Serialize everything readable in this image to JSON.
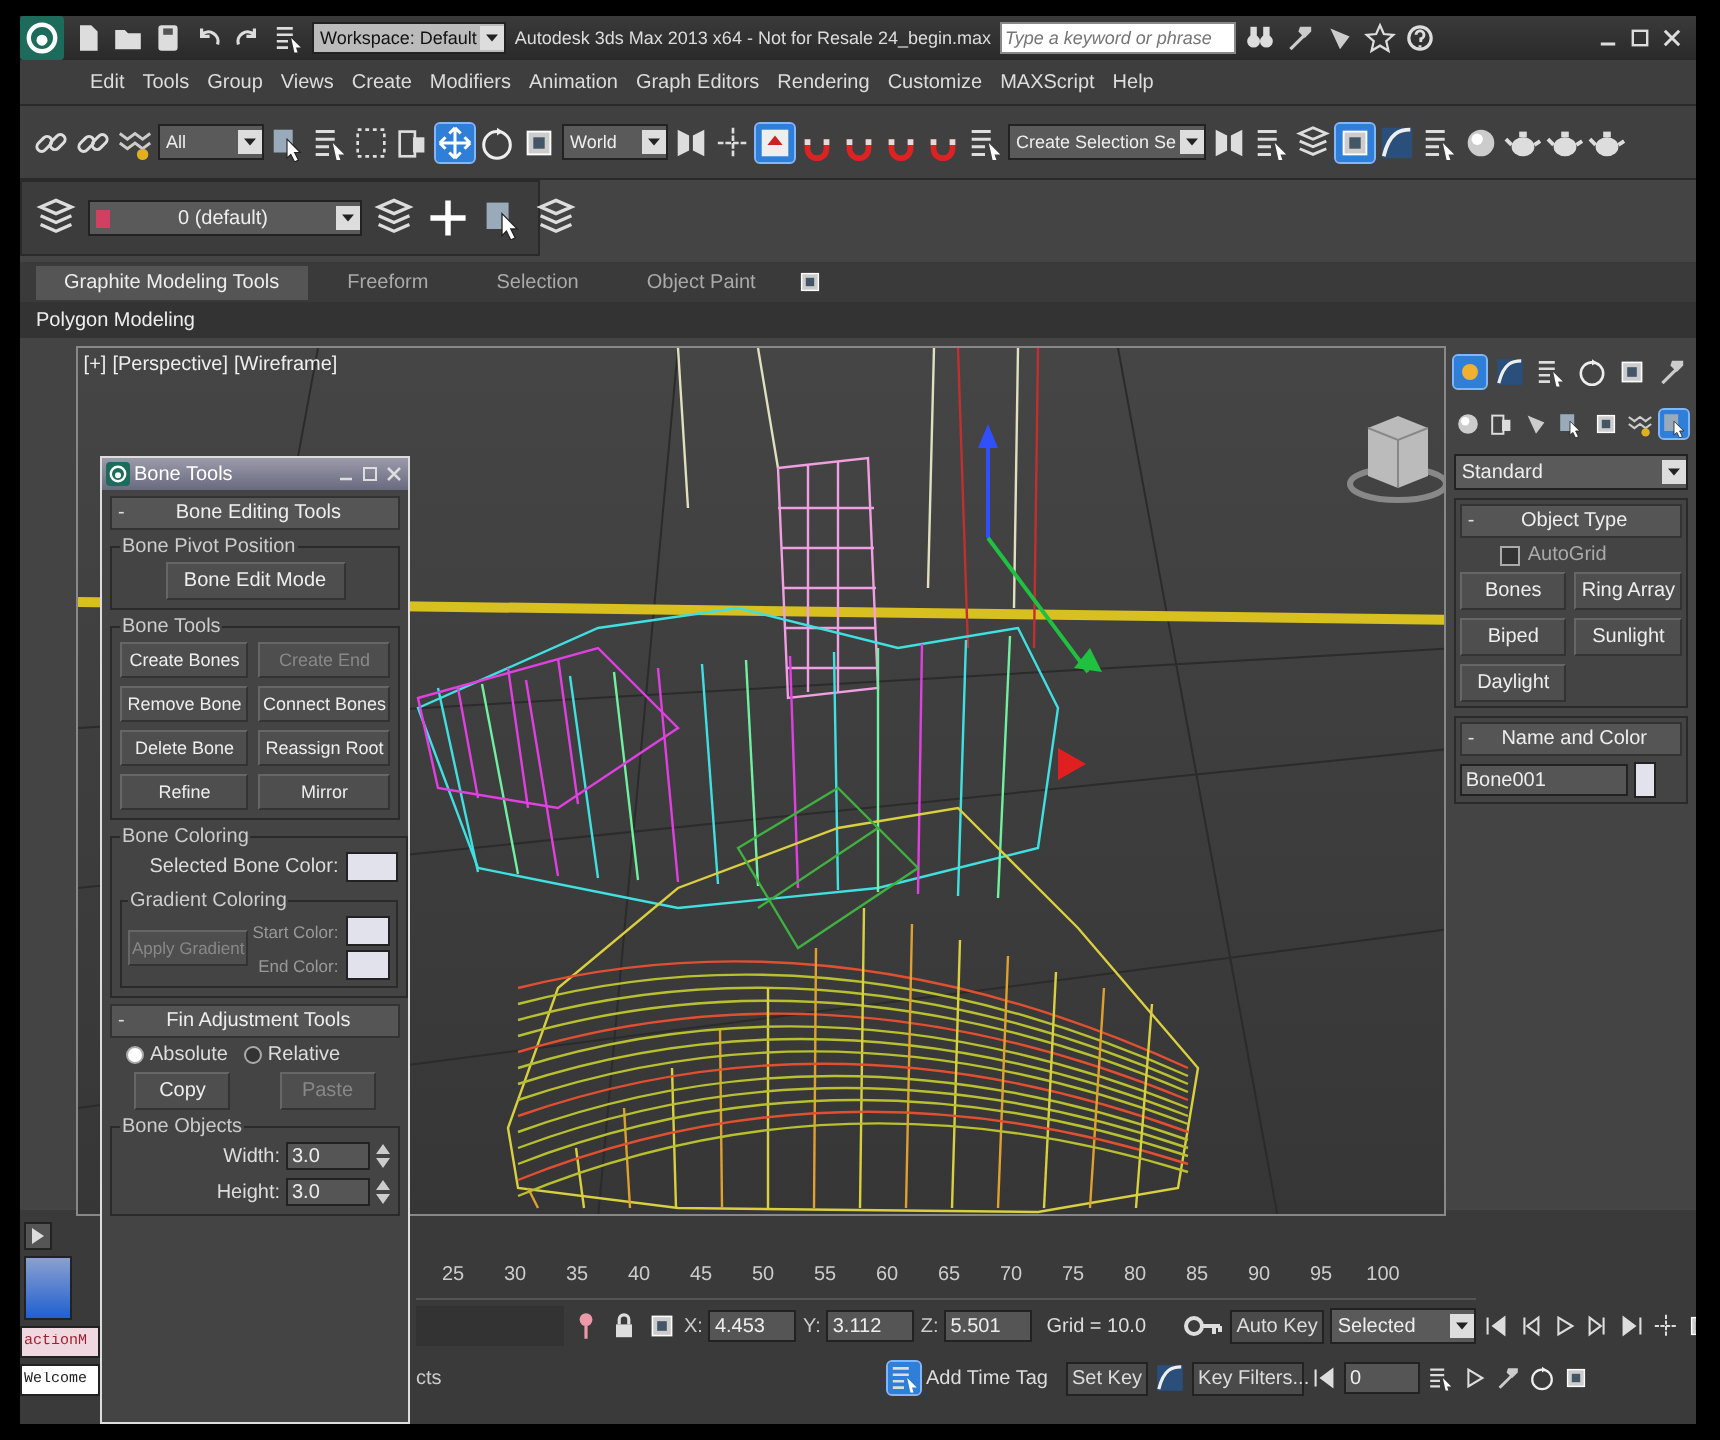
{
  "title_bar": {
    "workspace": "Workspace: Default",
    "title": "Autodesk 3ds Max  2013 x64  - Not for Resale   24_begin.max",
    "search": {
      "placeholder": "Type a keyword or phrase"
    }
  },
  "menu": [
    "Edit",
    "Tools",
    "Group",
    "Views",
    "Create",
    "Modifiers",
    "Animation",
    "Graph Editors",
    "Rendering",
    "Customize",
    "MAXScript",
    "Help"
  ],
  "main_toolbar": {
    "selection_filter": "All",
    "reference_coord": "World",
    "named_selection": "Create Selection Se",
    "tool_buttons": [
      {
        "selected": false
      },
      {
        "selected": false
      },
      {
        "selected": false
      },
      {
        "selected": false
      },
      {
        "selected": false
      },
      {
        "selected": false
      },
      {
        "selected": false
      },
      {
        "selected": true
      },
      {
        "selected": false
      },
      {
        "selected": false
      },
      {
        "selected": false
      },
      {
        "selected": false
      },
      {
        "selected": true
      },
      {
        "selected": false
      },
      {
        "selected": false
      },
      {
        "selected": false
      },
      {
        "selected": false
      },
      {
        "selected": false
      },
      {
        "selected": false
      },
      {
        "selected": false
      },
      {
        "selected": false
      },
      {
        "selected": true
      },
      {
        "selected": false
      },
      {
        "selected": false
      },
      {
        "selected": false
      },
      {
        "selected": false
      },
      {
        "selected": false
      },
      {
        "selected": false
      }
    ]
  },
  "layer_toolbar": {
    "layer": "0 (default)"
  },
  "ribbon": {
    "tabs": [
      {
        "label": "Graphite Modeling Tools",
        "selected": true
      },
      {
        "label": "Freeform",
        "selected": false
      },
      {
        "label": "Selection",
        "selected": false
      },
      {
        "label": "Object Paint",
        "selected": false
      }
    ],
    "panel": "Polygon Modeling"
  },
  "viewport": {
    "labels": [
      "[+]",
      "[Perspective]",
      "[Wireframe]"
    ]
  },
  "bone_tools": {
    "title": "Bone Tools",
    "editing": {
      "sign": "-",
      "title": "Bone Editing Tools",
      "pivot_group": "Bone Pivot Position",
      "edit_mode": "Bone Edit Mode",
      "tools_group": "Bone Tools",
      "buttons": [
        {
          "label": "Create Bones",
          "disabled": false
        },
        {
          "label": "Create End",
          "disabled": true
        },
        {
          "label": "Remove Bone",
          "disabled": false
        },
        {
          "label": "Connect Bones",
          "disabled": false
        },
        {
          "label": "Delete Bone",
          "disabled": false
        },
        {
          "label": "Reassign Root",
          "disabled": false
        },
        {
          "label": "Refine",
          "disabled": false
        },
        {
          "label": "Mirror",
          "disabled": false
        }
      ],
      "coloring_group": "Bone Coloring",
      "selected_color_label": "Selected Bone Color:",
      "gradient_group": "Gradient Coloring",
      "apply_gradient": {
        "label": "Apply Gradient",
        "disabled": true
      },
      "start_color": "Start Color:",
      "end_color": "End Color:"
    },
    "fin": {
      "sign": "-",
      "title": "Fin Adjustment Tools",
      "modes": [
        {
          "label": "Absolute",
          "selected": true
        },
        {
          "label": "Relative",
          "selected": false
        }
      ],
      "copy": {
        "label": "Copy",
        "disabled": false
      },
      "paste": {
        "label": "Paste",
        "disabled": true
      },
      "objects_group": "Bone Objects",
      "fields": [
        {
          "label": "Width:",
          "value": "3.0"
        },
        {
          "label": "Height:",
          "value": "3.0"
        }
      ]
    }
  },
  "command_panel": {
    "tabs": [
      {
        "selected": true
      },
      {
        "selected": false
      },
      {
        "selected": false
      },
      {
        "selected": false
      },
      {
        "selected": false
      },
      {
        "selected": false
      }
    ],
    "subcategories": [
      {
        "selected": false
      },
      {
        "selected": false
      },
      {
        "selected": false
      },
      {
        "selected": false
      },
      {
        "selected": false
      },
      {
        "selected": false
      },
      {
        "selected": true
      }
    ],
    "category": "Standard",
    "object_type": {
      "sign": "-",
      "title": "Object Type",
      "autogrid": {
        "label": "AutoGrid",
        "checked": false
      },
      "buttons": [
        "Bones",
        "Ring Array",
        "Biped",
        "Sunlight",
        "Daylight"
      ]
    },
    "name_and_color": {
      "sign": "-",
      "title": "Name and Color",
      "name": "Bone001"
    }
  },
  "timeline": {
    "ticks": [
      "25",
      "30",
      "35",
      "40",
      "45",
      "50",
      "55",
      "60",
      "65",
      "70",
      "75",
      "80",
      "85",
      "90",
      "95",
      "100"
    ]
  },
  "status_bar": {
    "listener": [
      "actionM",
      "Welcome"
    ],
    "prompt": "cts",
    "coords": [
      {
        "label": "X:",
        "value": "4.453"
      },
      {
        "label": "Y:",
        "value": "3.112"
      },
      {
        "label": "Z:",
        "value": "5.501"
      }
    ],
    "grid": "Grid = 10.0",
    "add_time_tag": "Add Time Tag",
    "auto_key": "Auto Key",
    "key_mode": "Selected",
    "set_key": "Set Key",
    "key_filters": "Key Filters...",
    "frame": "0"
  }
}
